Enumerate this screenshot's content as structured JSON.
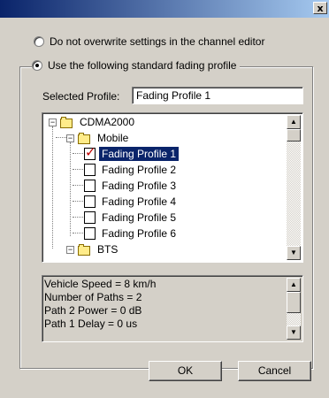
{
  "window": {
    "close_label": "x"
  },
  "options": {
    "no_overwrite_label": "Do not overwrite settings in the channel editor",
    "use_profile_label": "Use the following standard fading profile"
  },
  "selected_profile": {
    "label": "Selected Profile:",
    "value": "Fading Profile 1"
  },
  "tree": {
    "root": "CDMA2000",
    "mobile": "Mobile",
    "profiles": [
      "Fading Profile 1",
      "Fading Profile 2",
      "Fading Profile 3",
      "Fading Profile 4",
      "Fading Profile 5",
      "Fading Profile 6"
    ],
    "bts": "BTS"
  },
  "info": {
    "lines": [
      "Vehicle Speed = 8 km/h",
      "Number of Paths = 2",
      "Path 2 Power = 0 dB",
      "Path 1 Delay = 0 us"
    ]
  },
  "buttons": {
    "ok": "OK",
    "cancel": "Cancel"
  }
}
